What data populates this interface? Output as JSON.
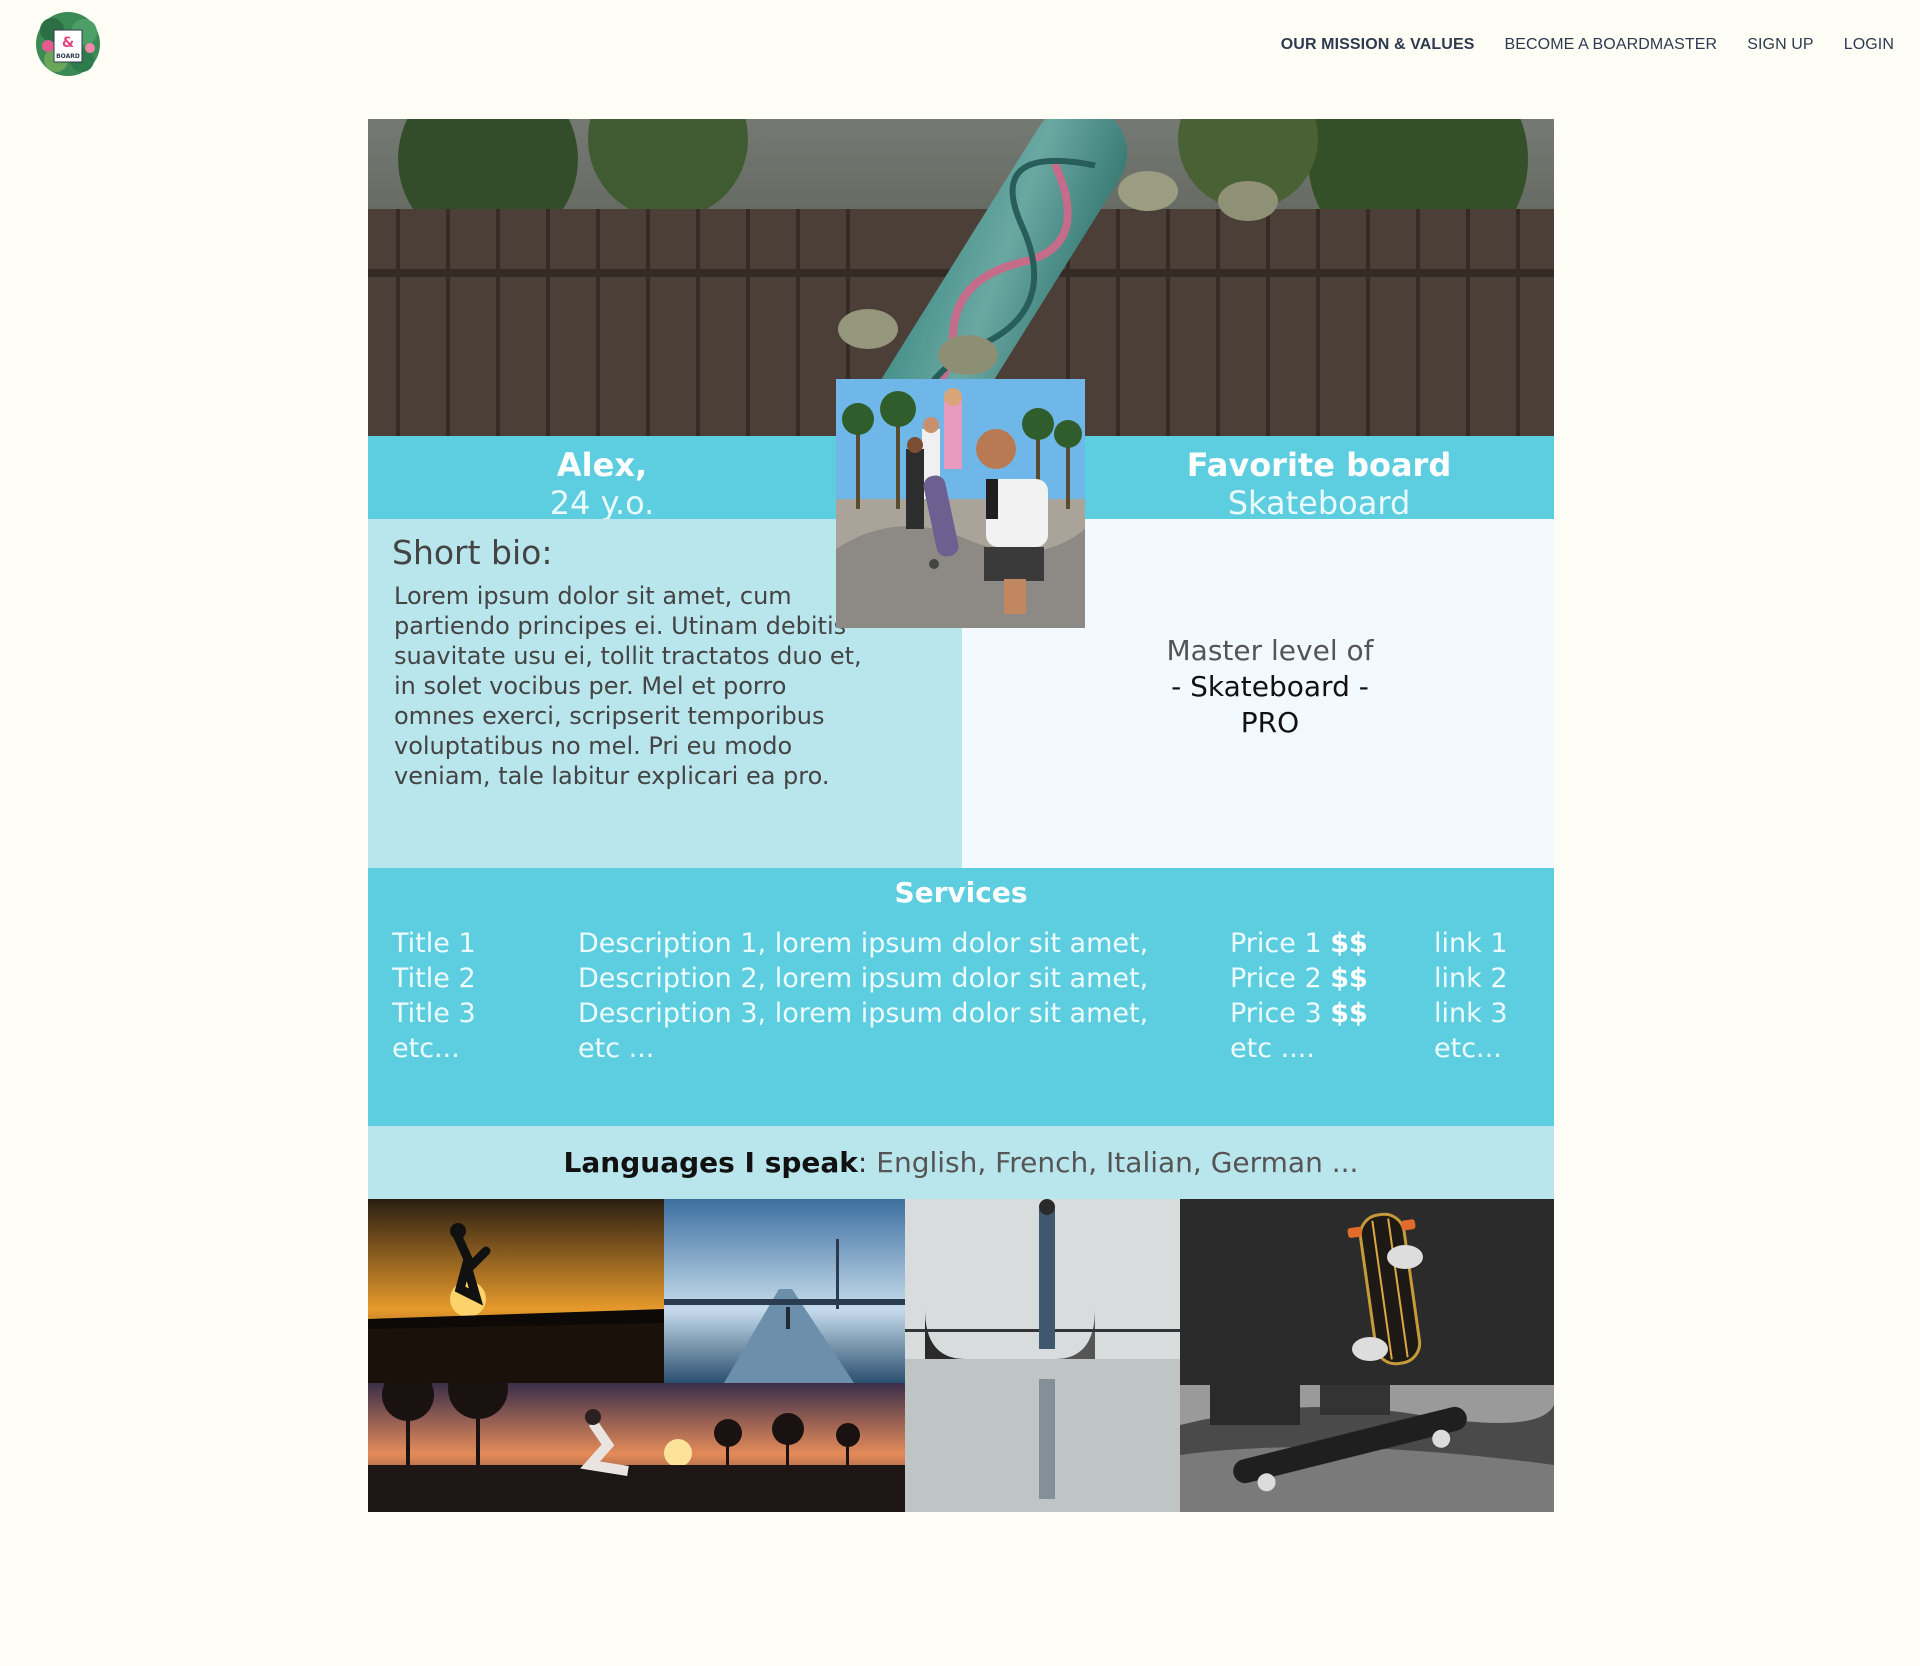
{
  "brand": {
    "logo_text": "& BOARD"
  },
  "nav": {
    "items": [
      {
        "label": "OUR MISSION & VALUES",
        "active": true
      },
      {
        "label": "BECOME A BOARDMASTER",
        "active": false
      },
      {
        "label": "SIGN UP",
        "active": false
      },
      {
        "label": "LOGIN",
        "active": false
      }
    ]
  },
  "profile": {
    "name": "Alex,",
    "age": "24 y.o.",
    "favorite_label": "Favorite board",
    "favorite_value": "Skateboard",
    "bio_title": "Short bio:",
    "bio_text": "Lorem ipsum dolor sit amet, cum partiendo principes ei. Utinam debitis suavitate usu ei, tollit tractatos duo et, in solet vocibus per. Mel et porro omnes exerci, scripserit temporibus voluptatibus no mel. Pri eu modo veniam, tale labitur explicari ea pro.",
    "master_prefix": "Master level of",
    "master_board": "- Skateboard -",
    "master_level": "PRO"
  },
  "services": {
    "title": "Services",
    "titles": [
      "Title 1",
      "Title 2",
      "Title 3",
      "etc..."
    ],
    "descriptions": [
      "Description 1, lorem ipsum dolor sit amet,",
      "Description 2, lorem ipsum dolor sit amet,",
      "Description 3, lorem ipsum dolor sit amet,",
      "etc ..."
    ],
    "prices": [
      "Price 1",
      "Price 2",
      "Price 3",
      "etc ...."
    ],
    "price_suffix": "$$",
    "links": [
      "link 1",
      "link 2",
      "link 3",
      "etc..."
    ]
  },
  "languages": {
    "label": "Languages I speak",
    "value": "English, French, Italian, German ..."
  },
  "colors": {
    "band": "#5dcde0",
    "bio_bg": "#b9e6ec",
    "master_bg": "#f2faff",
    "page_bg": "#fefef6",
    "nav_text": "#2e3a4f"
  }
}
